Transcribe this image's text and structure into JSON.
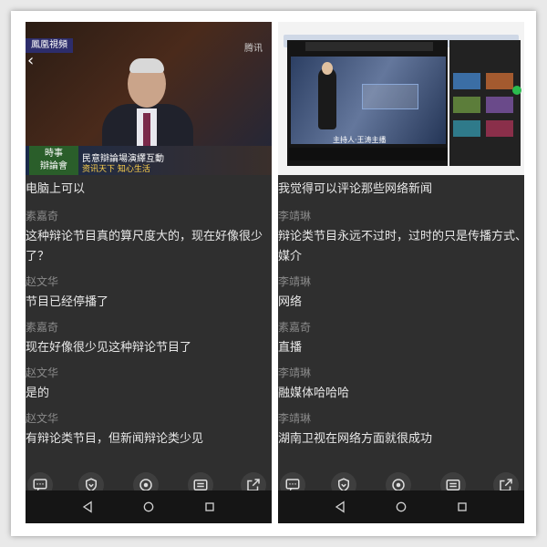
{
  "left": {
    "video": {
      "channel_logo": "鳳凰視頻",
      "watermark": "腾讯",
      "caption_tag": "時事\n辯論會",
      "caption_line1": "民意辯論場演繹互動",
      "caption_line2": "资讯天下 知心生活"
    },
    "comments": [
      {
        "name": "",
        "text": "电脑上可以"
      },
      {
        "name": "素嘉奇",
        "text": ""
      },
      {
        "name": "",
        "text": "这种辩论节目真的算尺度大的，现在好像很少"
      },
      {
        "name": "",
        "text": "了？"
      },
      {
        "name": "赵文华",
        "text": ""
      },
      {
        "name": "",
        "text": "节目已经停播了"
      },
      {
        "name": "素嘉奇",
        "text": ""
      },
      {
        "name": "",
        "text": "现在好像很少见这种辩论节目了"
      },
      {
        "name": "赵文华",
        "text": ""
      },
      {
        "name": "",
        "text": "是的"
      },
      {
        "name": "赵文华",
        "text": ""
      },
      {
        "name": "",
        "text": "有辩论类节目，但新闻辩论类少见"
      }
    ]
  },
  "right": {
    "player": {
      "presenter_caption": "主持人·王涛主播"
    },
    "comments": [
      {
        "name": "",
        "text": "我觉得可以评论那些网络新闻"
      },
      {
        "name": "李靖琳",
        "text": ""
      },
      {
        "name": "",
        "text": "辩论类节目永远不过时，过时的只是传播方式、"
      },
      {
        "name": "",
        "text": "媒介"
      },
      {
        "name": "李靖琳",
        "text": ""
      },
      {
        "name": "",
        "text": "网络"
      },
      {
        "name": "素嘉奇",
        "text": ""
      },
      {
        "name": "",
        "text": "直播"
      },
      {
        "name": "李靖琳",
        "text": ""
      },
      {
        "name": "",
        "text": "融媒体哈哈哈"
      },
      {
        "name": "李靖琳",
        "text": ""
      },
      {
        "name": "",
        "text": "湖南卫视在网络方面就很成功"
      }
    ]
  },
  "icons": {
    "actions": [
      "comment-icon",
      "shield-icon",
      "target-icon",
      "list-icon",
      "share-icon"
    ],
    "nav": [
      "back-icon",
      "home-icon",
      "recents-icon"
    ]
  },
  "colors": {
    "panel_bg": "#2f2f2f",
    "name_color": "#8a8a8a",
    "text_color": "#e8e8e8"
  }
}
